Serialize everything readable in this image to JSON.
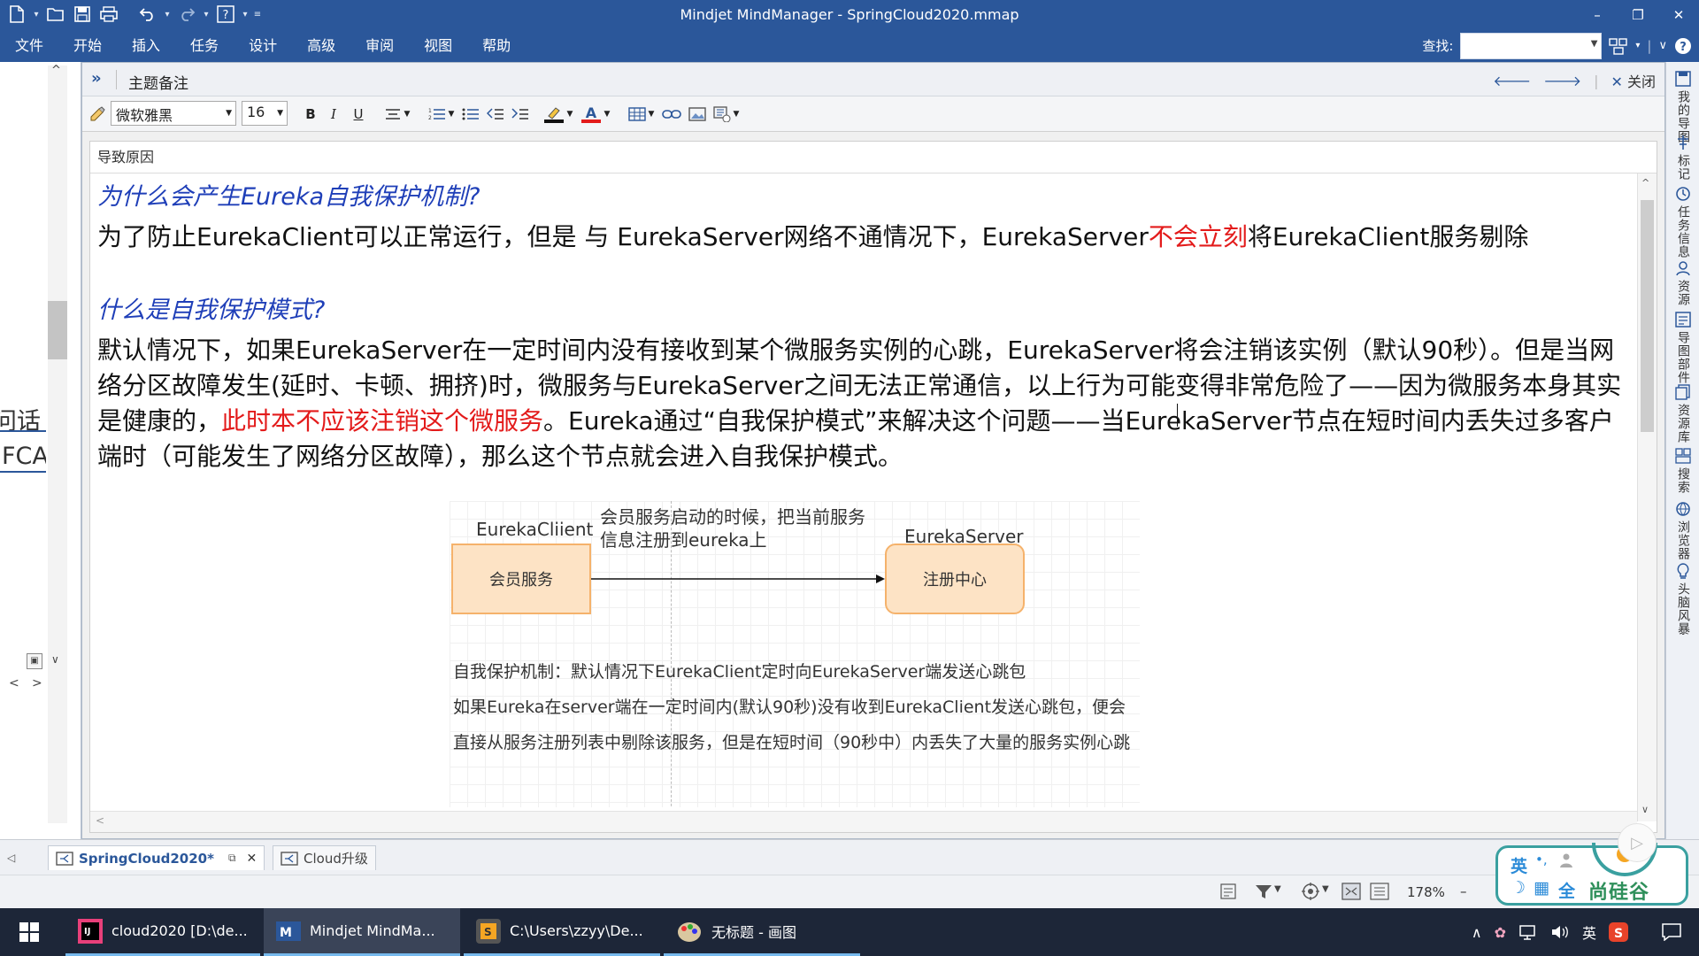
{
  "window": {
    "title": "Mindjet MindManager - SpringCloud2020.mmap",
    "minimize": "–",
    "maximize": "❐",
    "close": "✕"
  },
  "menu": [
    "文件",
    "开始",
    "插入",
    "任务",
    "设计",
    "高级",
    "审阅",
    "视图",
    "帮助"
  ],
  "search": {
    "label": "查找:",
    "value": ""
  },
  "left_panel": {
    "text1": "问话",
    "text2": "FCA"
  },
  "notes": {
    "title": "主题备注",
    "close_label": "关闭",
    "font_name": "微软雅黑",
    "font_size": "16",
    "bold": "B",
    "italic": "I",
    "underline": "U",
    "topic": "导致原因"
  },
  "content": {
    "h1": "为什么会产生Eureka自我保护机制?",
    "p1_a": "为了防止EurekaClient可以正常运行，但是 与 EurekaServer网络不通情况下，EurekaServer",
    "p1_red": "不会立刻",
    "p1_b": "将EurekaClient服务剔除",
    "h2": "什么是自我保护模式?",
    "p2_a": "默认情况下，如果EurekaServer在一定时间内没有接收到某个微服务实例的心跳，EurekaServer将会注销该实例（默认90秒）。但是当网络分区故障发生(延时、卡顿、拥挤)时，微服务与EurekaServer之间无法正常通信，以上行为可能变得非常危险了——因为微服务本身其实是健康的，",
    "p2_red": "此时本不应该注销这个微服务",
    "p2_b": "。Eureka通过“自我保护模式”来解决这个问题——当EurekaServer节点在短时间内丢失过多客户端时（可能发生了网络分区故障），那么这个节点就会进入自我保护模式。"
  },
  "diagram": {
    "client_label": "EurekaCliient",
    "server_label": "EurekaServer",
    "note_line1": "会员服务启动的时候，把当前服务",
    "note_line2": "信息注册到eureka上",
    "box_left": "会员服务",
    "box_right": "注册中心",
    "desc1": "自我保护机制：默认情况下EurekaClient定时向EurekaServer端发送心跳包",
    "desc2": "如果Eureka在server端在一定时间内(默认90秒)没有收到EurekaClient发送心跳包，便会",
    "desc3": "直接从服务注册列表中剔除该服务，但是在短时间（90秒中）内丢失了大量的服务实例心跳",
    "box_fill": "#fde3c5",
    "box_stroke": "#f5b26b"
  },
  "right_sidebar": [
    "我的导图",
    "标记",
    "任务信息",
    "资源",
    "导图部件",
    "资源库",
    "搜索",
    "浏览器",
    "头脑风暴"
  ],
  "doc_tabs": [
    {
      "label": "SpringCloud2020*"
    },
    {
      "label": "Cloud升级"
    }
  ],
  "status": {
    "zoom": "178%"
  },
  "taskbar": {
    "items": [
      {
        "label": "cloud2020 [D:\\de..."
      },
      {
        "label": "Mindjet MindMa..."
      },
      {
        "label": "C:\\Users\\zzyy\\De..."
      },
      {
        "label": "无标题 - 画图"
      }
    ],
    "ime": "英"
  },
  "watermark": {
    "brand": "尚硅谷",
    "ime1": "英",
    "ime2": "全"
  },
  "colors": {
    "ribbon": "#2b579a",
    "heading": "#1f3fb8",
    "highlight_red": "#e31b1b"
  }
}
